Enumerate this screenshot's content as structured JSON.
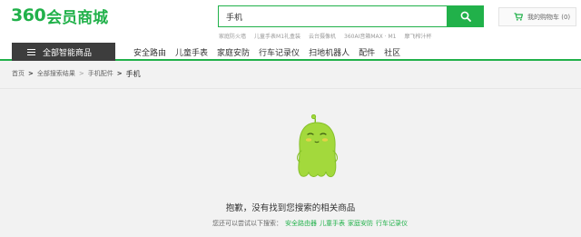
{
  "header": {
    "logo_number": "360",
    "logo_text": "会员商城",
    "search": {
      "value": "手机"
    },
    "hot_words": [
      "家庭防火墙",
      "儿童手表M1礼盒装",
      "云台摄像机",
      "360AI音箱MAX · M1",
      "摩飞榨汁杯"
    ],
    "cart_label": "我的购物车 (0)"
  },
  "nav": {
    "all_categories": "全部智能商品",
    "items": [
      "安全路由",
      "儿童手表",
      "家庭安防",
      "行车记录仪",
      "扫地机器人",
      "配件",
      "社区"
    ]
  },
  "breadcrumb": {
    "home": "首页",
    "search_results": "全部搜索结果",
    "category": "手机配件",
    "current": "手机"
  },
  "empty_state": {
    "message": "抱歉，没有找到您搜索的相关商品",
    "suggest_prefix": "您还可以尝试以下搜索：",
    "suggestions": [
      "安全路由器",
      "儿童手表",
      "家庭安防",
      "行车记录仪"
    ]
  },
  "colors": {
    "brand_green": "#21b14a",
    "nav_dark": "#3d3d3d",
    "mascot_green": "#a3d93c"
  }
}
